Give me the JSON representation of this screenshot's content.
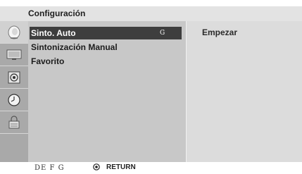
{
  "header": {
    "title": "Configuración"
  },
  "sidebar": {
    "items": [
      {
        "icon": "satellite-dish-icon",
        "active": true
      },
      {
        "icon": "monitor-icon",
        "active": false
      },
      {
        "icon": "speaker-icon",
        "active": false
      },
      {
        "icon": "clock-icon",
        "active": false
      },
      {
        "icon": "lock-icon",
        "active": false
      }
    ]
  },
  "menu": {
    "items": [
      {
        "label": "Sinto. Auto",
        "key": "G",
        "selected": true
      },
      {
        "label": "Sintonización Manual",
        "key": "",
        "selected": false
      },
      {
        "label": "Favorito",
        "key": "",
        "selected": false
      }
    ]
  },
  "right_panel": {
    "action": "Empezar"
  },
  "footer": {
    "keys": "DE F G",
    "return_label": "RETURN"
  },
  "colors": {
    "selected_bg": "#3e3e3e",
    "main_panel": "#c8c8c8",
    "right_panel": "#dcdcdc",
    "sidebar": "#a9a9a9"
  }
}
